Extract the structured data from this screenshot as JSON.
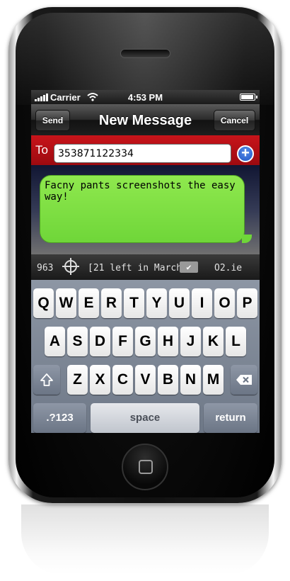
{
  "status_bar": {
    "carrier": "Carrier",
    "time": "4:53 PM"
  },
  "nav": {
    "title": "New Message",
    "send_label": "Send",
    "cancel_label": "Cancel"
  },
  "to": {
    "label": "To",
    "value": "353871122334"
  },
  "message": {
    "text": "Facny pants screenshots the easy way!"
  },
  "info": {
    "count": "963",
    "remaining": "[21 left in March]",
    "provider": "O2.ie"
  },
  "keyboard": {
    "row1": [
      "Q",
      "W",
      "E",
      "R",
      "T",
      "Y",
      "U",
      "I",
      "O",
      "P"
    ],
    "row2": [
      "A",
      "S",
      "D",
      "F",
      "G",
      "H",
      "J",
      "K",
      "L"
    ],
    "row3": [
      "Z",
      "X",
      "C",
      "V",
      "B",
      "N",
      "M"
    ],
    "numbers_label": ".?123",
    "space_label": "space",
    "return_label": "return"
  },
  "icons": [
    "signal-icon",
    "wifi-icon",
    "battery-icon",
    "add-contact-icon",
    "crosshair-icon",
    "check-icon",
    "shift-icon",
    "backspace-icon",
    "home-button-icon"
  ],
  "colors": {
    "bubble": "#7bdd3f",
    "to_bar": "#b30f15",
    "add_icon": "#2a62d4"
  }
}
